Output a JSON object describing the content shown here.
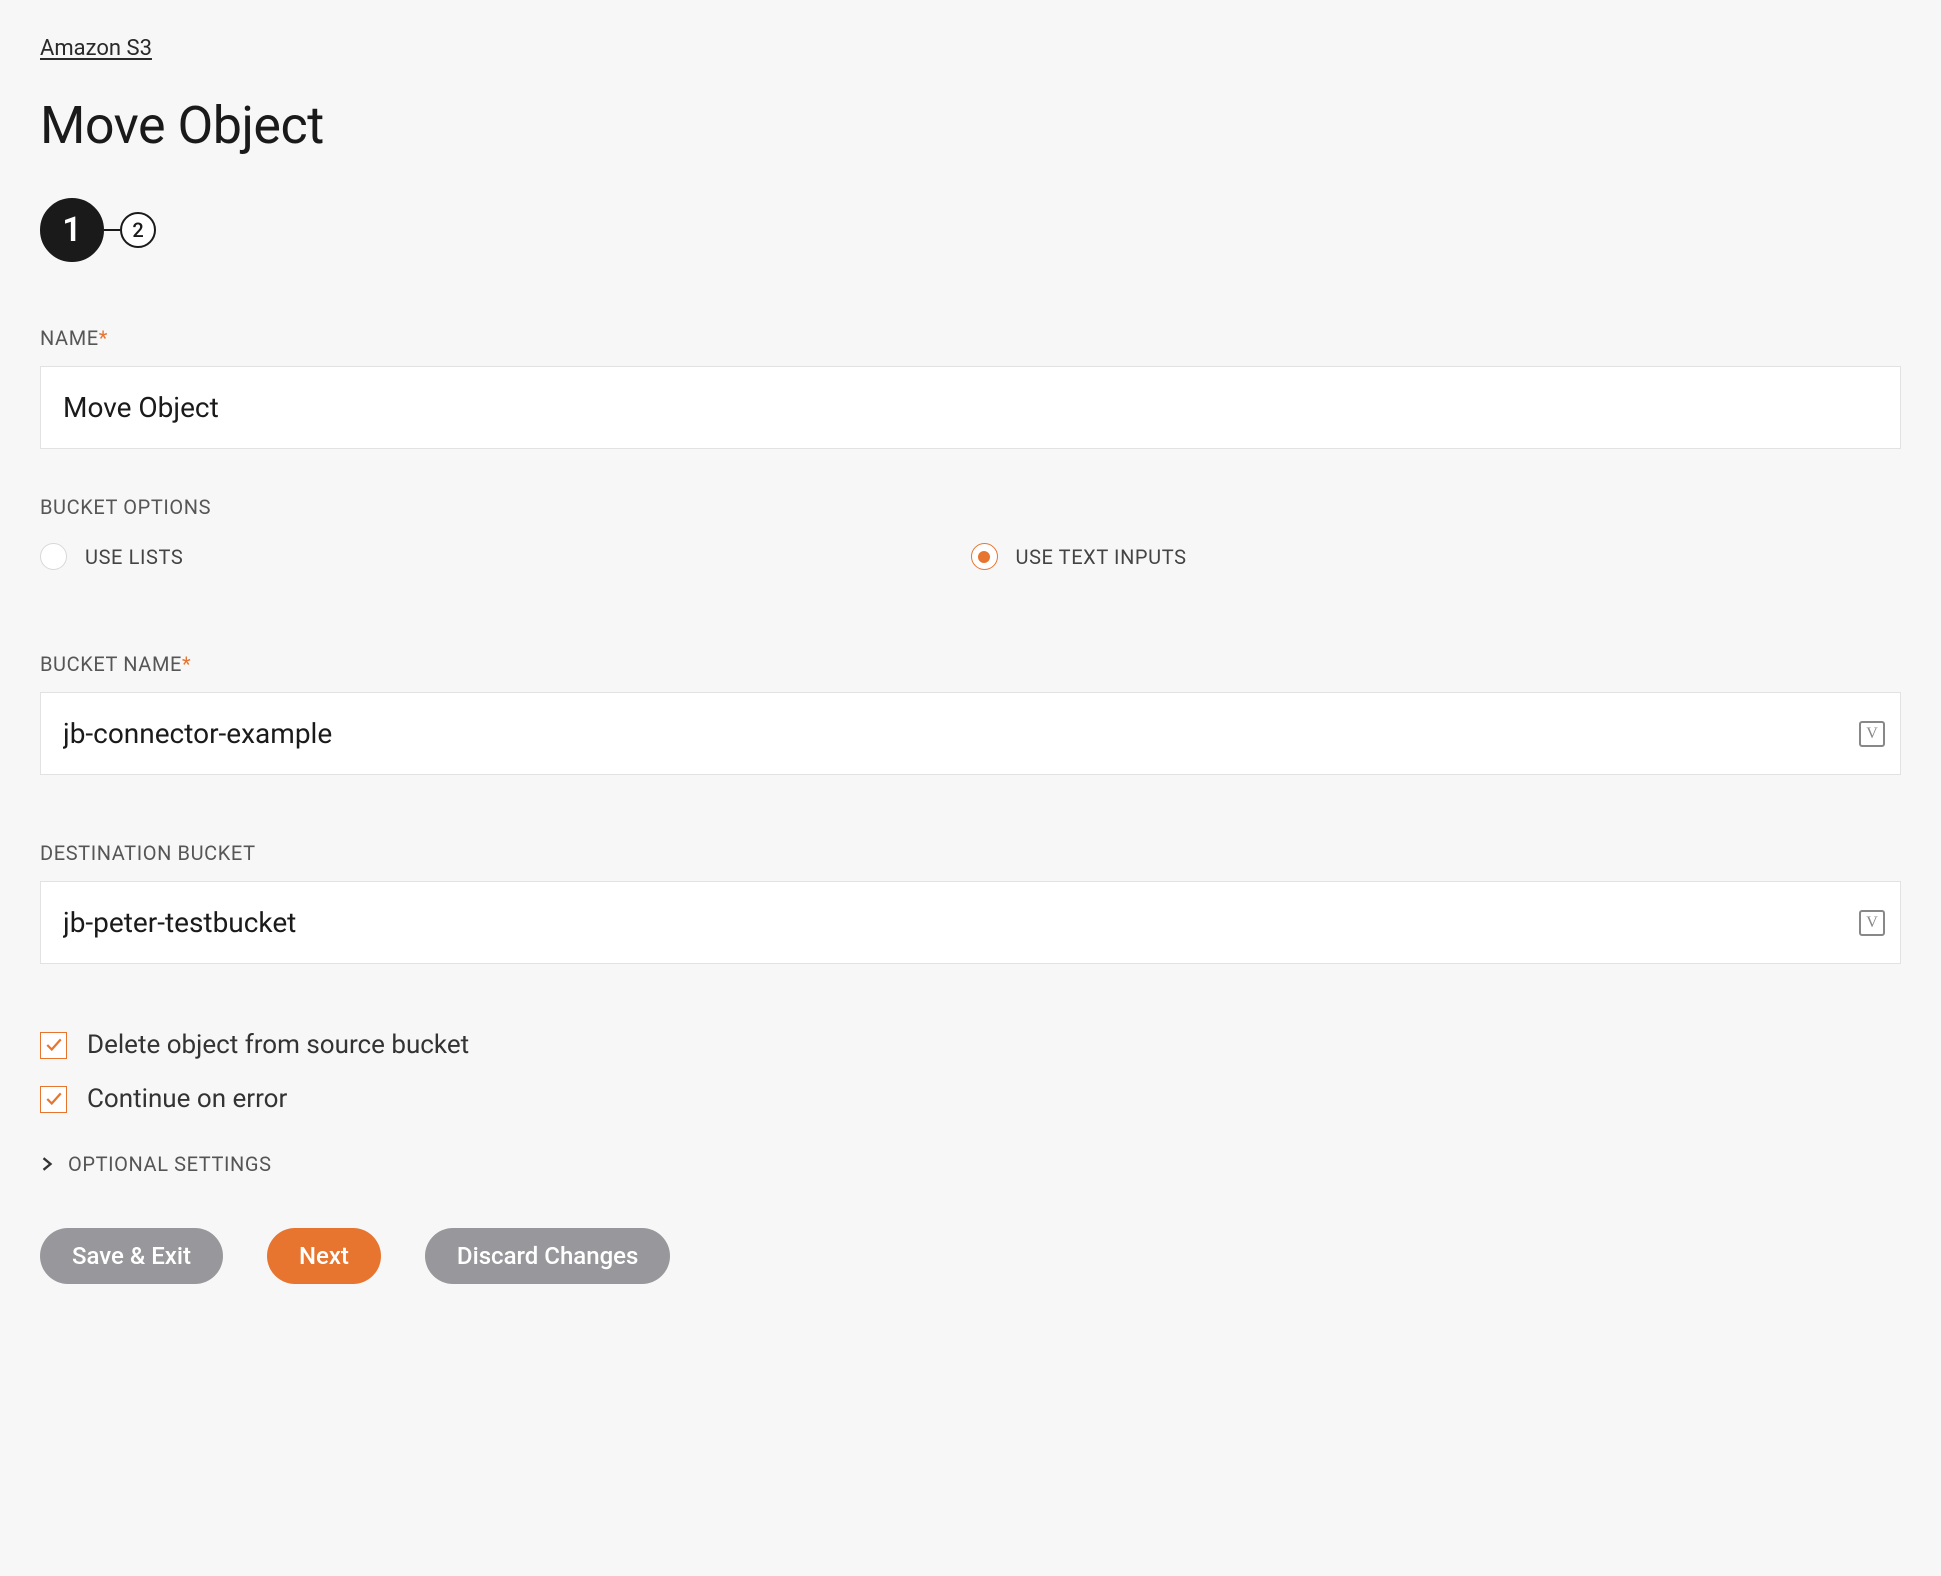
{
  "breadcrumb": "Amazon S3",
  "page_title": "Move Object",
  "steps": {
    "s1": "1",
    "s2": "2"
  },
  "name_field": {
    "label": "NAME",
    "value": "Move Object"
  },
  "bucket_options": {
    "label": "BUCKET OPTIONS",
    "opt1": "USE LISTS",
    "opt2": "USE TEXT INPUTS"
  },
  "bucket_name": {
    "label": "BUCKET NAME",
    "value": "jb-connector-example"
  },
  "destination_bucket": {
    "label": "DESTINATION BUCKET",
    "value": "jb-peter-testbucket"
  },
  "check_delete": "Delete object from source bucket",
  "check_continue": "Continue on error",
  "optional_settings": "OPTIONAL SETTINGS",
  "buttons": {
    "save_exit": "Save & Exit",
    "next": "Next",
    "discard": "Discard Changes"
  },
  "variable_glyph": "V"
}
